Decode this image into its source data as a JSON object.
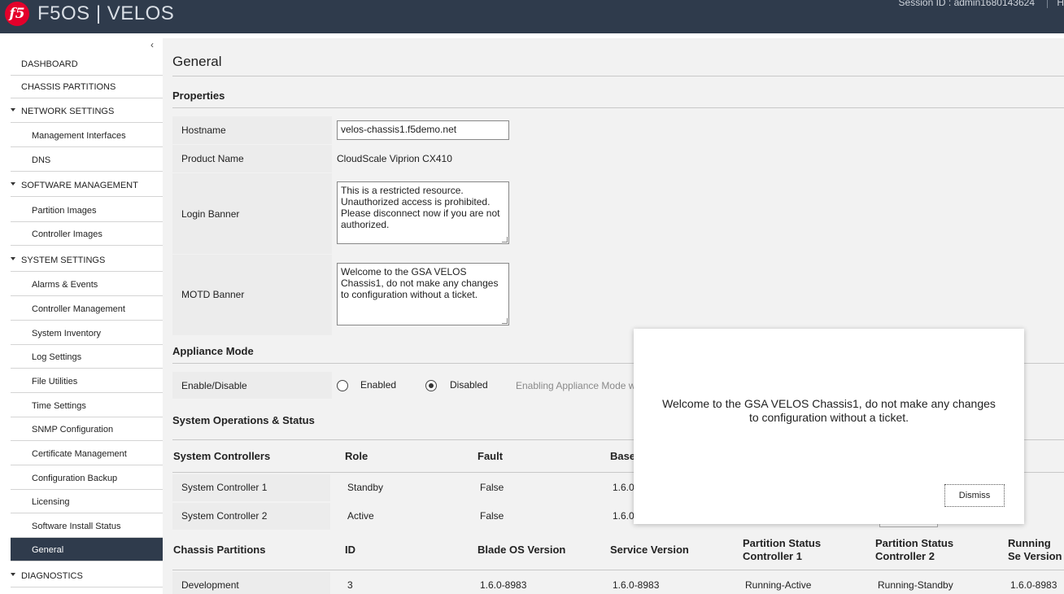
{
  "header": {
    "logo_text": "f5",
    "brand": "F5OS | VELOS",
    "session": "Session ID : admin1680143624",
    "extra": "H"
  },
  "sidebar": {
    "collapse_glyph": "‹",
    "items": [
      {
        "label": "DASHBOARD"
      },
      {
        "label": "CHASSIS PARTITIONS"
      },
      {
        "label": "NETWORK SETTINGS"
      },
      {
        "label": "Management Interfaces"
      },
      {
        "label": "DNS"
      },
      {
        "label": "SOFTWARE MANAGEMENT"
      },
      {
        "label": "Partition Images"
      },
      {
        "label": "Controller Images"
      },
      {
        "label": "SYSTEM SETTINGS"
      },
      {
        "label": "Alarms & Events"
      },
      {
        "label": "Controller Management"
      },
      {
        "label": "System Inventory"
      },
      {
        "label": "Log Settings"
      },
      {
        "label": "File Utilities"
      },
      {
        "label": "Time Settings"
      },
      {
        "label": "SNMP Configuration"
      },
      {
        "label": "Certificate Management"
      },
      {
        "label": "Configuration Backup"
      },
      {
        "label": "Licensing"
      },
      {
        "label": "Software Install Status"
      },
      {
        "label": "General"
      },
      {
        "label": "DIAGNOSTICS"
      }
    ]
  },
  "main": {
    "title": "General",
    "properties_heading": "Properties",
    "hostname_label": "Hostname",
    "hostname_value": "velos-chassis1.f5demo.net",
    "product_label": "Product Name",
    "product_value": "CloudScale Viprion CX410",
    "login_banner_label": "Login Banner",
    "login_banner_value": "This is a restricted resource.\nUnauthorized access is prohibited.\nPlease disconnect now if you are not\nauthorized.",
    "motd_label": "MOTD Banner",
    "motd_value": "Welcome to the GSA VELOS\nChassis1, do not make any changes\nto configuration without a ticket.",
    "appliance_heading": "Appliance Mode",
    "enable_label": "Enable/Disable",
    "enabled_label": "Enabled",
    "disabled_label": "Disabled",
    "appliance_hint": "Enabling Appliance Mode w",
    "ops_heading": "System Operations & Status",
    "controllers_table": {
      "headers": [
        "System Controllers",
        "Role",
        "Fault",
        "Base"
      ],
      "rows": [
        [
          "System Controller 1",
          "Standby",
          "False",
          "1.6.0"
        ],
        [
          "System Controller 2",
          "Active",
          "False",
          "1.6.0"
        ]
      ]
    },
    "partitions_table": {
      "headers": [
        "Chassis Partitions",
        "ID",
        "Blade OS Version",
        "Service Version",
        "Partition Status Controller 1",
        "Partition Status Controller 2",
        "Running Se Version"
      ],
      "rows": [
        [
          "Development",
          "3",
          "1.6.0-8983",
          "1.6.0-8983",
          "Running-Active",
          "Running-Standby",
          "1.6.0-8983"
        ]
      ]
    }
  },
  "modal": {
    "message": "Welcome to the GSA VELOS Chassis1, do not make any changes to configuration without a ticket.",
    "dismiss_label": "Dismiss"
  }
}
